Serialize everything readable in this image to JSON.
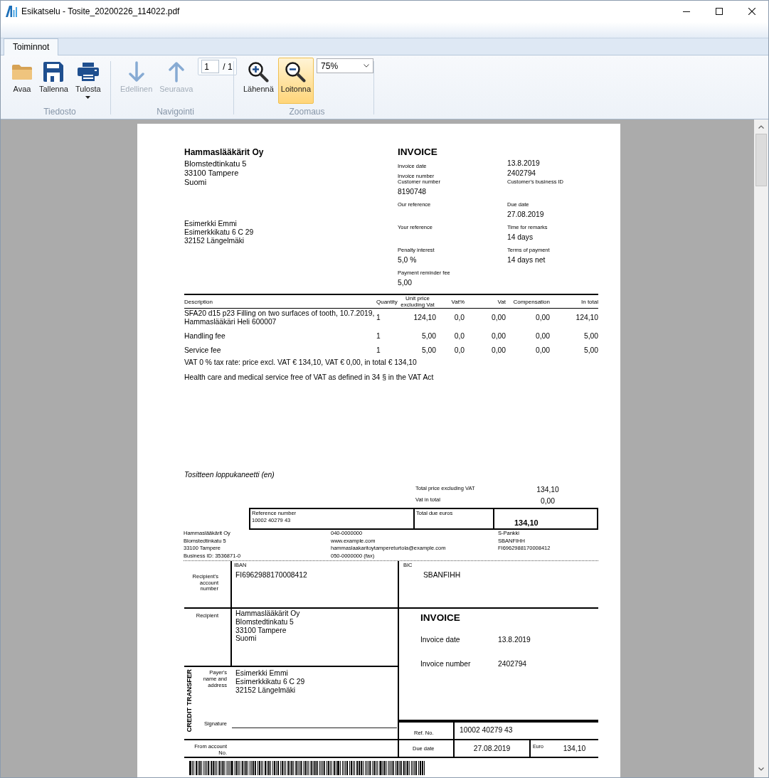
{
  "window": {
    "title": "Esikatselu - Tosite_20200226_114022.pdf"
  },
  "tabs": [
    {
      "label": "Toiminnot",
      "selected": true
    }
  ],
  "ribbon": {
    "groups": [
      {
        "label": "Tiedosto",
        "items": [
          {
            "kind": "button",
            "label": "Avaa",
            "disabled": false,
            "selected": false
          },
          {
            "kind": "button",
            "label": "Tallenna",
            "disabled": false,
            "selected": false
          },
          {
            "kind": "menu-button",
            "label": "Tulosta",
            "disabled": false,
            "selected": false
          }
        ]
      },
      {
        "label": "Navigointi",
        "items": [
          {
            "kind": "button",
            "label": "Edellinen",
            "disabled": true,
            "selected": false
          },
          {
            "kind": "button",
            "label": "Seuraava",
            "disabled": true,
            "selected": false
          },
          {
            "kind": "page-field",
            "value": "1",
            "total": "/ 1"
          }
        ]
      },
      {
        "label": "Zoomaus",
        "items": [
          {
            "kind": "button",
            "label": "Lähennä",
            "disabled": false,
            "selected": false
          },
          {
            "kind": "button",
            "label": "Loitonna",
            "disabled": false,
            "selected": true
          },
          {
            "kind": "combo",
            "value": "75%"
          }
        ]
      }
    ]
  },
  "document": {
    "sender": {
      "name": "Hammaslääkärit Oy",
      "address": [
        "Blomstedtinkatu 5",
        "33100 Tampere",
        "Suomi"
      ]
    },
    "recipient": {
      "address": [
        "Esimerkki Emmi",
        "Esimerkkikatu 6 C 29",
        "32152 Längelmäki"
      ]
    },
    "invoice": {
      "title": "INVOICE",
      "rows": [
        {
          "label": "Invoice date",
          "value": "13.8.2019"
        },
        {
          "label": "Invoice number",
          "value": "2402794"
        }
      ],
      "fields": [
        {
          "label": "Customer number",
          "value": "8190748"
        },
        {
          "label": "Customer's business ID"
        },
        {
          "label": "Our reference"
        },
        {
          "label": "Due date",
          "value": "27.08.2019"
        },
        {
          "label": "Your reference"
        },
        {
          "label": "Time for remarks",
          "value": "14 days"
        },
        {
          "label": "Penalty interest",
          "value": "5,0 %"
        },
        {
          "label": "Terms of payment",
          "value": "14 days net"
        },
        {
          "label": "Payment reminder fee",
          "value": "5,00"
        }
      ]
    },
    "items_table": {
      "columns": [
        "Description",
        "Quantity",
        "Unit price excluding Vat",
        "Vat%",
        "Vat",
        "Compensation",
        "In total"
      ],
      "rows": [
        [
          "SFA20 d15 p23 Filling on two surfaces of tooth, 10.7.2019, Hammaslääkäri Heli 600007",
          "1",
          "124,10",
          "0,0",
          "0,00",
          "0,00",
          "124,10"
        ],
        [
          "Handling fee",
          "1",
          "5,00",
          "0,0",
          "0,00",
          "0,00",
          "5,00"
        ],
        [
          "Service fee",
          "1",
          "5,00",
          "0,0",
          "0,00",
          "0,00",
          "5,00"
        ]
      ]
    },
    "vat_summary": "VAT 0 % tax rate: price excl. VAT € 134,10, VAT € 0,00, in total € 134,10",
    "vat_note": "Health care and medical service free of VAT as defined in 34 § in the VAT Act",
    "closing_note": "Tositteen loppukaneetti (en)",
    "totals": [
      {
        "label": "Total price excluding VAT",
        "value": "134,10"
      },
      {
        "label": "Vat in total",
        "value": "0,00"
      }
    ],
    "payment_box": {
      "reference_label": "Reference number",
      "reference": "10002 40279 43",
      "total_label": "Total due euros",
      "total": "134,10"
    },
    "footer": [
      [
        "Hammaslääkärit Oy",
        "Blomstedtinkatu 5",
        "33100 Tampere",
        "Business ID: 3536871-0"
      ],
      [
        "040-0000000",
        "www.example.com",
        "hammaslaakaritoytampereturtola@example.com",
        "050-0000000 (fax)"
      ],
      [
        "S-Pankki",
        "SBANFIHH",
        "FI6962988170008412"
      ]
    ],
    "giro": {
      "account_label": "Recipient's account number",
      "iban_label": "IBAN",
      "iban": "FI6962988170008412",
      "bic_label": "BIC",
      "bic": "SBANFIHH",
      "recipient_label": "Recipient",
      "recipient_address": [
        "Hammaslääkärit Oy",
        "Blomstedtinkatu 5",
        "33100 Tampere",
        "Suomi"
      ],
      "invoice_title": "INVOICE",
      "invoice_rows": [
        {
          "label": "Invoice date",
          "value": "13.8.2019"
        },
        {
          "label": "Invoice number",
          "value": "2402794"
        }
      ],
      "side_label": "CREDIT TRANSFER",
      "payer_label": "Payer's name and address",
      "payer_address": [
        "Esimerkki Emmi",
        "Esimerkkikatu 6 C 29",
        "32152 Längelmäki"
      ],
      "signature_label": "Signature",
      "ref_label": "Ref. No.",
      "ref": "10002 40279 43",
      "from_account_label": "From account No.",
      "due_label": "Due date",
      "due": "27.08.2019",
      "euro_label": "Euro",
      "amount": "134,10"
    }
  }
}
